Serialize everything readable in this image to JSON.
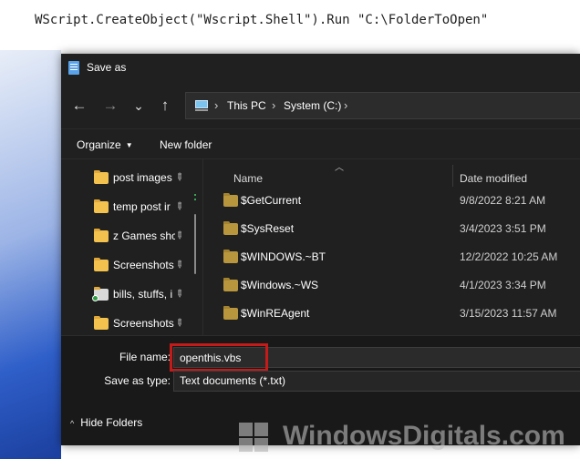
{
  "editor": {
    "code": "WScript.CreateObject(\"Wscript.Shell\").Run \"C:\\FolderToOpen\""
  },
  "dialog": {
    "title": "Save as",
    "nav": {
      "back": "←",
      "forward": "→",
      "recent": "⌄",
      "up": "↑"
    },
    "address": {
      "icon": "this-pc-icon",
      "crumbs": [
        "This PC",
        "System (C:)"
      ],
      "separator": "›"
    },
    "toolbar": {
      "organize": "Organize",
      "new_folder": "New folder"
    },
    "nav_pane": {
      "items": [
        {
          "label": "post images",
          "icon": "folder-icon",
          "pinned": true
        },
        {
          "label": "temp post ir",
          "icon": "folder-icon",
          "pinned": true
        },
        {
          "label": "z Games shc",
          "icon": "folder-icon",
          "pinned": true
        },
        {
          "label": "Screenshots",
          "icon": "folder-icon",
          "pinned": true
        },
        {
          "label": "bills, stuffs, i",
          "icon": "folder-synced-icon",
          "pinned": true
        },
        {
          "label": "Screenshots",
          "icon": "folder-icon",
          "pinned": true
        }
      ]
    },
    "file_list": {
      "columns": {
        "name": "Name",
        "date_modified": "Date modified"
      },
      "rows": [
        {
          "name": "$GetCurrent",
          "date": "9/8/2022 8:21 AM"
        },
        {
          "name": "$SysReset",
          "date": "3/4/2023 3:51 PM"
        },
        {
          "name": "$WINDOWS.~BT",
          "date": "12/2/2022 10:25 AM"
        },
        {
          "name": "$Windows.~WS",
          "date": "4/1/2023 3:34 PM"
        },
        {
          "name": "$WinREAgent",
          "date": "3/15/2023 11:57 AM"
        }
      ]
    },
    "file_name": {
      "label": "File name:",
      "value": "openthis.vbs"
    },
    "save_as_type": {
      "label": "Save as type:",
      "value": "Text documents (*.txt)"
    },
    "hide_folders": {
      "chevron": "^",
      "label": "Hide Folders"
    },
    "colors": {
      "background": "#202020",
      "highlight": "#c41a1a",
      "folder": "#f2c14e"
    }
  },
  "watermark": {
    "text": "WindowsDigitals.com"
  }
}
